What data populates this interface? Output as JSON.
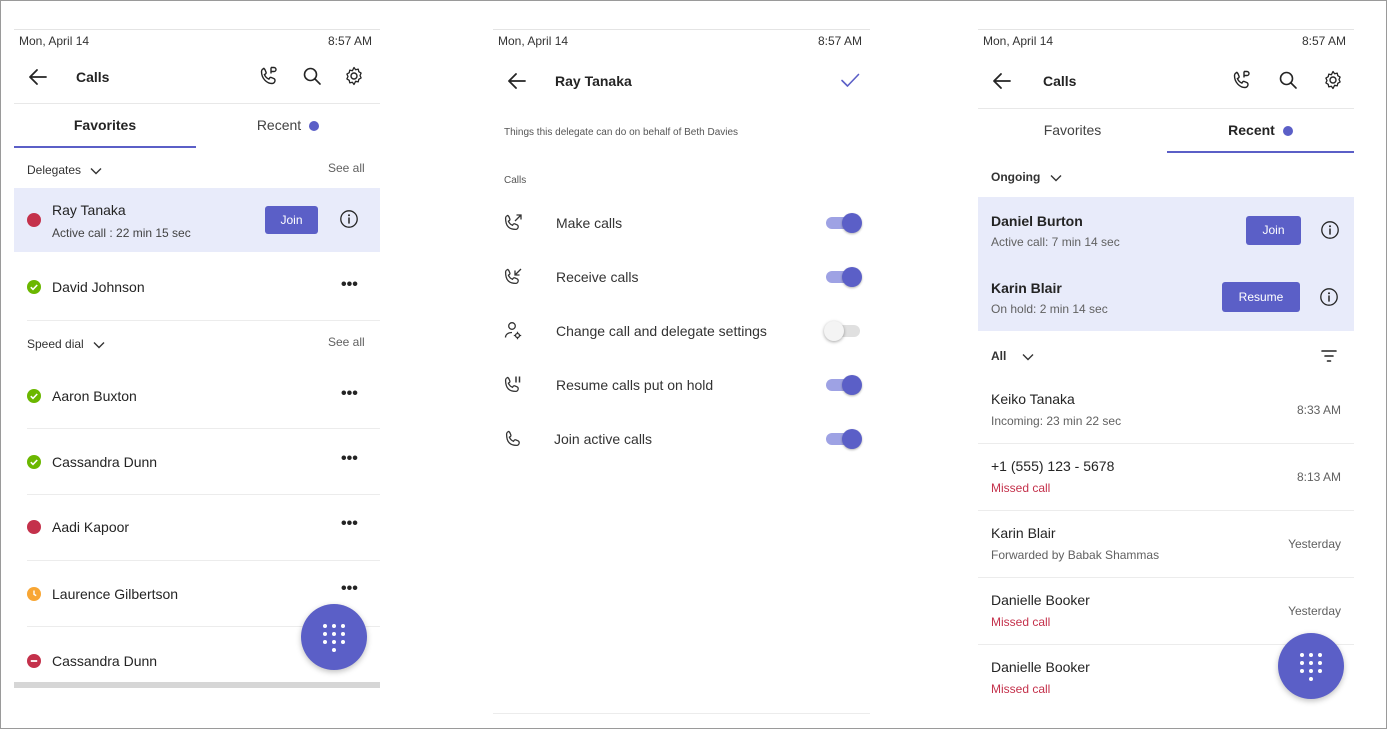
{
  "colors": {
    "accent": "#5b5fc7",
    "highlight": "#e8ebfa",
    "missed": "#c4314b",
    "available": "#6bb700",
    "busy": "#c4314b",
    "away": "#f8a634",
    "dnd": "#c4314b"
  },
  "left": {
    "status": {
      "date": "Mon, April 14",
      "time": "8:57 AM"
    },
    "header": {
      "title": "Calls"
    },
    "tabs": [
      {
        "label": "Favorites",
        "active": true
      },
      {
        "label": "Recent",
        "badge": true
      }
    ],
    "delegates": {
      "title": "Delegates",
      "see_all": "See all",
      "items": [
        {
          "name": "Ray Tanaka",
          "sub": "Active call : 22 min 15 sec",
          "presence": "busy",
          "action": "Join"
        },
        {
          "name": "David Johnson",
          "presence": "available"
        }
      ]
    },
    "speed_dial": {
      "title": "Speed dial",
      "see_all": "See all",
      "items": [
        {
          "name": "Aaron Buxton",
          "presence": "available"
        },
        {
          "name": "Cassandra Dunn",
          "presence": "available"
        },
        {
          "name": "Aadi Kapoor",
          "presence": "busy"
        },
        {
          "name": "Laurence Gilbertson",
          "presence": "away"
        },
        {
          "name": "Cassandra Dunn",
          "presence": "dnd"
        }
      ]
    },
    "more_label": "•••"
  },
  "middle": {
    "status": {
      "date": "Mon, April 14",
      "time": "8:57 AM"
    },
    "header": {
      "title": "Ray Tanaka"
    },
    "description": "Things this delegate can do on behalf of Beth Davies",
    "section": "Calls",
    "permissions": [
      {
        "label": "Make calls",
        "icon": "outgoing-call-icon",
        "enabled": true
      },
      {
        "label": "Receive calls",
        "icon": "incoming-call-icon",
        "enabled": true
      },
      {
        "label": "Change call and delegate settings",
        "icon": "person-settings-icon",
        "enabled": false
      },
      {
        "label": "Resume calls put on hold",
        "icon": "call-pause-icon",
        "enabled": true
      },
      {
        "label": "Join active calls",
        "icon": "phone-icon",
        "enabled": true
      }
    ]
  },
  "right": {
    "status": {
      "date": "Mon, April 14",
      "time": "8:57 AM"
    },
    "header": {
      "title": "Calls"
    },
    "tabs": [
      {
        "label": "Favorites"
      },
      {
        "label": "Recent",
        "active": true,
        "badge": true
      }
    ],
    "ongoing": {
      "title": "Ongoing",
      "items": [
        {
          "name": "Daniel Burton",
          "sub": "Active call: 7 min 14 sec",
          "action": "Join"
        },
        {
          "name": "Karin Blair",
          "sub": "On hold: 2 min 14 sec",
          "action": "Resume"
        }
      ]
    },
    "filter": {
      "label": "All"
    },
    "recent": [
      {
        "name": "Keiko Tanaka",
        "sub": "Incoming: 23 min 22 sec",
        "time": "8:33 AM",
        "missed": false
      },
      {
        "name": "+1 (555) 123 - 5678",
        "sub": "Missed call",
        "time": "8:13 AM",
        "missed": true
      },
      {
        "name": "Karin Blair",
        "sub": "Forwarded by Babak Shammas",
        "time": "Yesterday",
        "missed": false
      },
      {
        "name": "Danielle Booker",
        "sub": "Missed call",
        "time": "Yesterday",
        "missed": true
      },
      {
        "name": "Danielle Booker",
        "sub": "Missed call",
        "time": "",
        "missed": true
      }
    ]
  }
}
